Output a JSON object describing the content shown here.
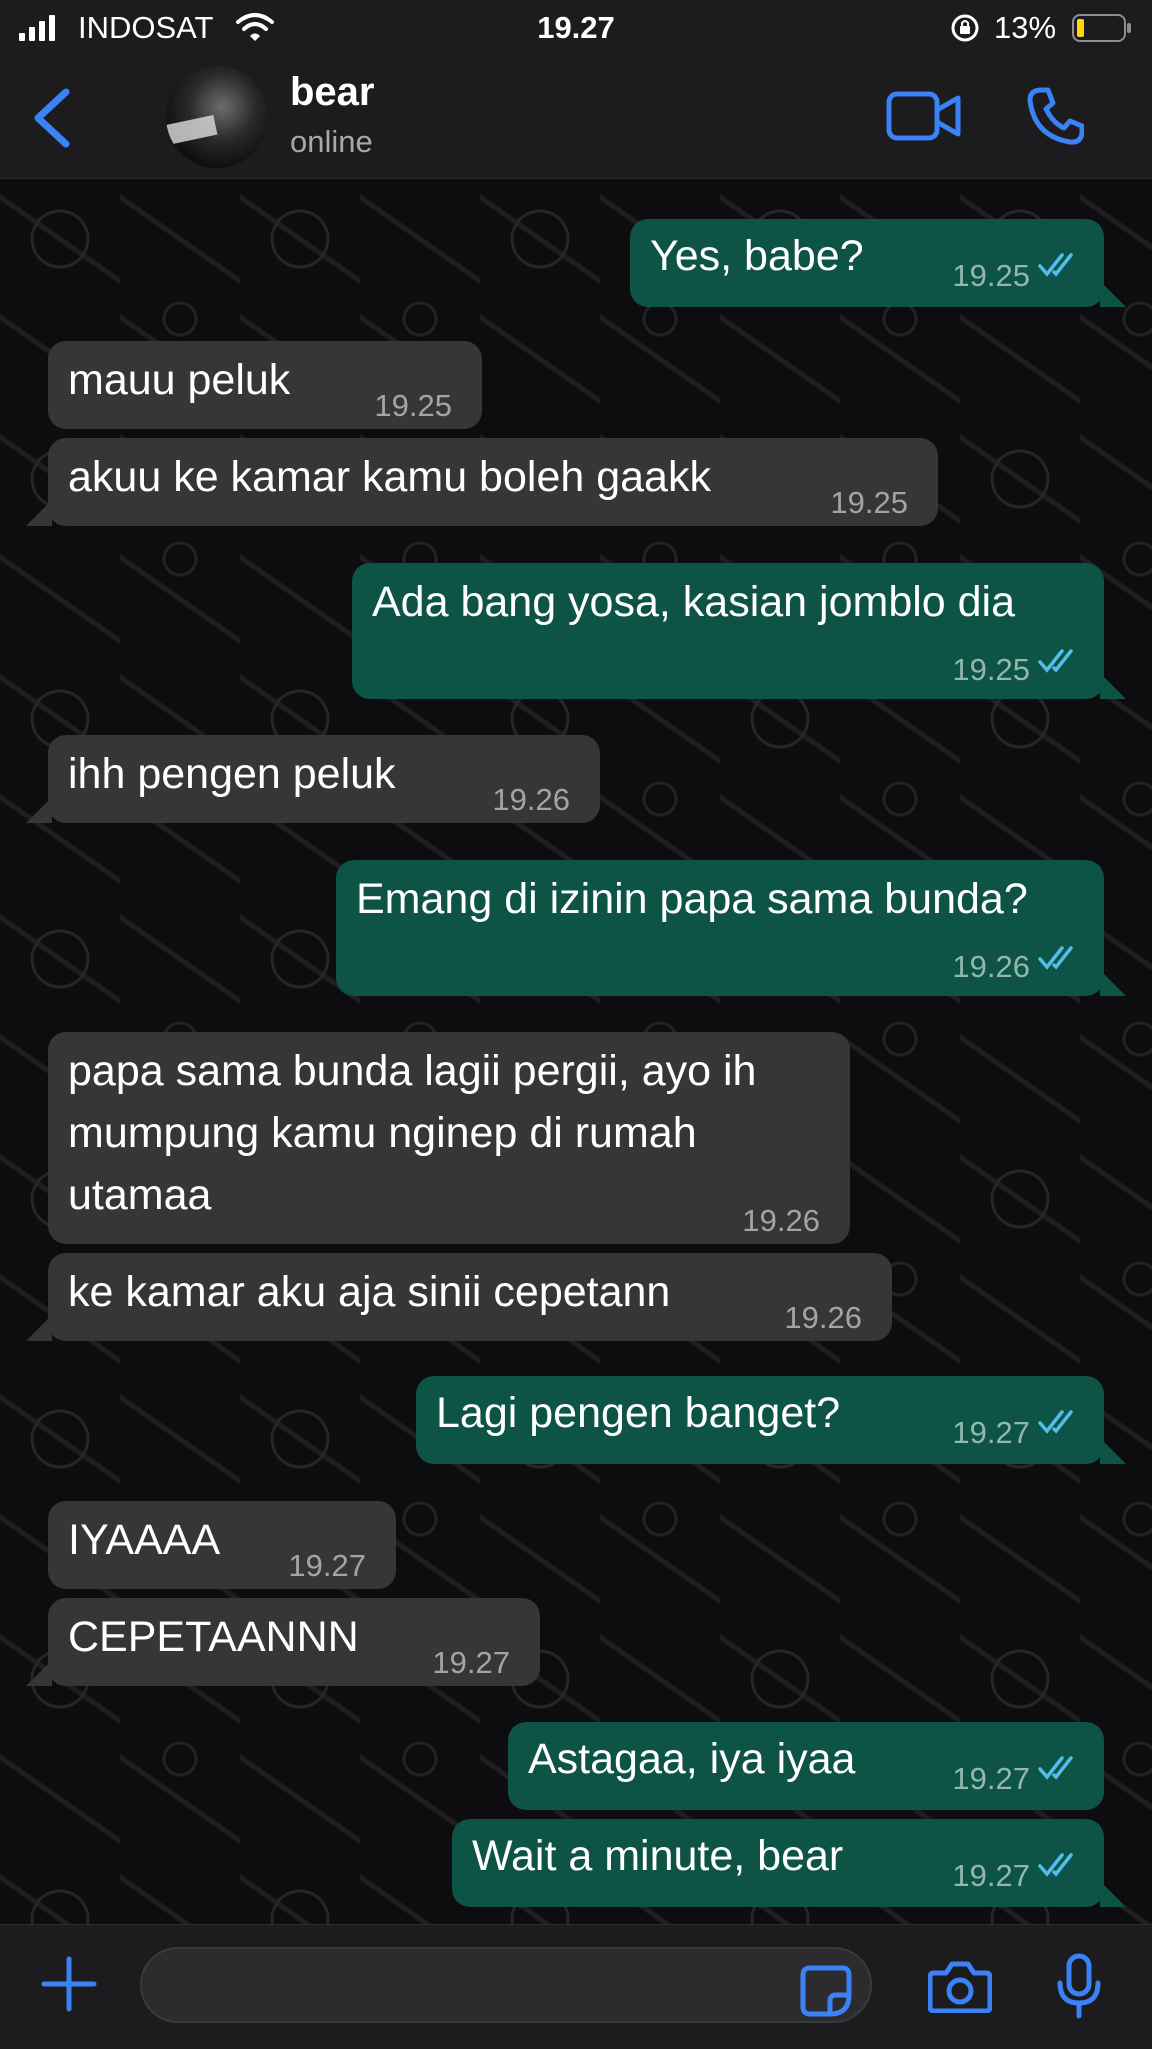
{
  "status_bar": {
    "carrier": "INDOSAT",
    "time": "19.27",
    "battery_percent": "13%"
  },
  "header": {
    "contact_name": "bear",
    "contact_status": "online"
  },
  "messages": [
    {
      "direction": "out",
      "text": "Yes, babe?",
      "time": "19.25",
      "read": true
    },
    {
      "direction": "in",
      "text": "mauu peluk",
      "time": "19.25"
    },
    {
      "direction": "in",
      "text": "akuu ke kamar kamu boleh gaakk",
      "time": "19.25"
    },
    {
      "direction": "out",
      "text": "Ada bang yosa, kasian jomblo dia",
      "time": "19.25",
      "read": true
    },
    {
      "direction": "in",
      "text": "ihh pengen peluk",
      "time": "19.26"
    },
    {
      "direction": "out",
      "text": "Emang di izinin papa sama bunda?",
      "time": "19.26",
      "read": true
    },
    {
      "direction": "in",
      "lines": [
        "papa sama bunda lagii pergii, ayo ih",
        "mumpung kamu nginep di rumah",
        "utamaa"
      ],
      "time": "19.26"
    },
    {
      "direction": "in",
      "text": "ke kamar aku aja sinii cepetann",
      "time": "19.26"
    },
    {
      "direction": "out",
      "text": "Lagi pengen banget?",
      "time": "19.27",
      "read": true
    },
    {
      "direction": "in",
      "text": "IYAAAA",
      "time": "19.27"
    },
    {
      "direction": "in",
      "text": "CEPETAANNN",
      "time": "19.27"
    },
    {
      "direction": "out",
      "text": "Astagaa, iya iyaa",
      "time": "19.27",
      "read": true
    },
    {
      "direction": "out",
      "text": "Wait a minute, bear",
      "time": "19.27",
      "read": true
    }
  ],
  "colors": {
    "accent": "#3b82f6",
    "outgoing_bubble": "#0d5346",
    "incoming_bubble": "#363638",
    "read_ticks": "#53bdeb"
  },
  "icons": [
    "signal-icon",
    "wifi-icon",
    "rotation-lock-icon",
    "battery-icon",
    "back-chevron-icon",
    "video-call-icon",
    "phone-call-icon",
    "plus-icon",
    "sticker-icon",
    "camera-icon",
    "microphone-icon",
    "double-check-icon"
  ]
}
